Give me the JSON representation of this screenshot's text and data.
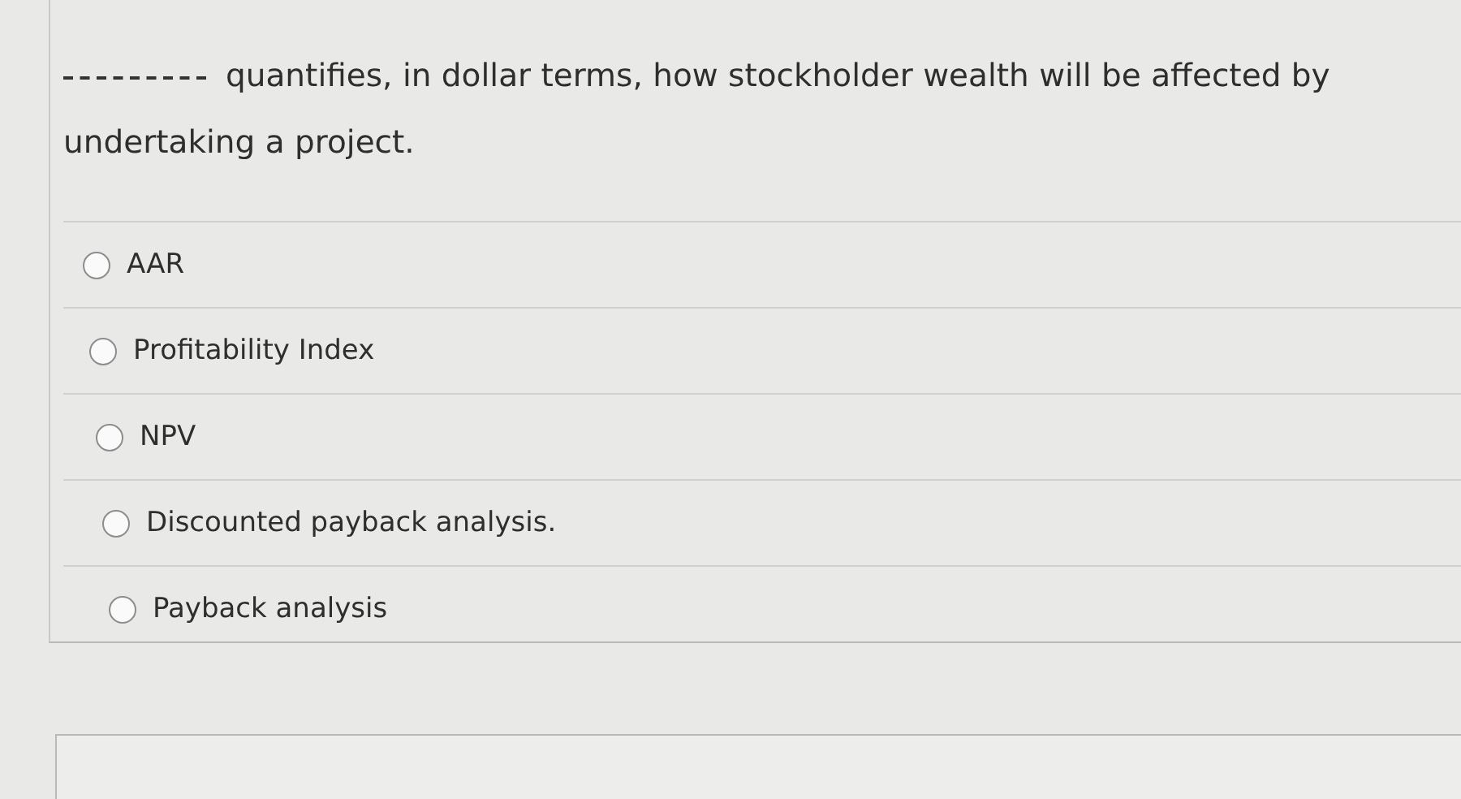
{
  "question": {
    "text": "quantifies, in dollar terms, how stockholder wealth will be affected by undertaking a project."
  },
  "options": [
    {
      "label": "AAR",
      "selected": false
    },
    {
      "label": "Profitability Index",
      "selected": false
    },
    {
      "label": "NPV",
      "selected": false
    },
    {
      "label": "Discounted payback analysis.",
      "selected": false
    },
    {
      "label": "Payback analysis",
      "selected": false
    }
  ]
}
